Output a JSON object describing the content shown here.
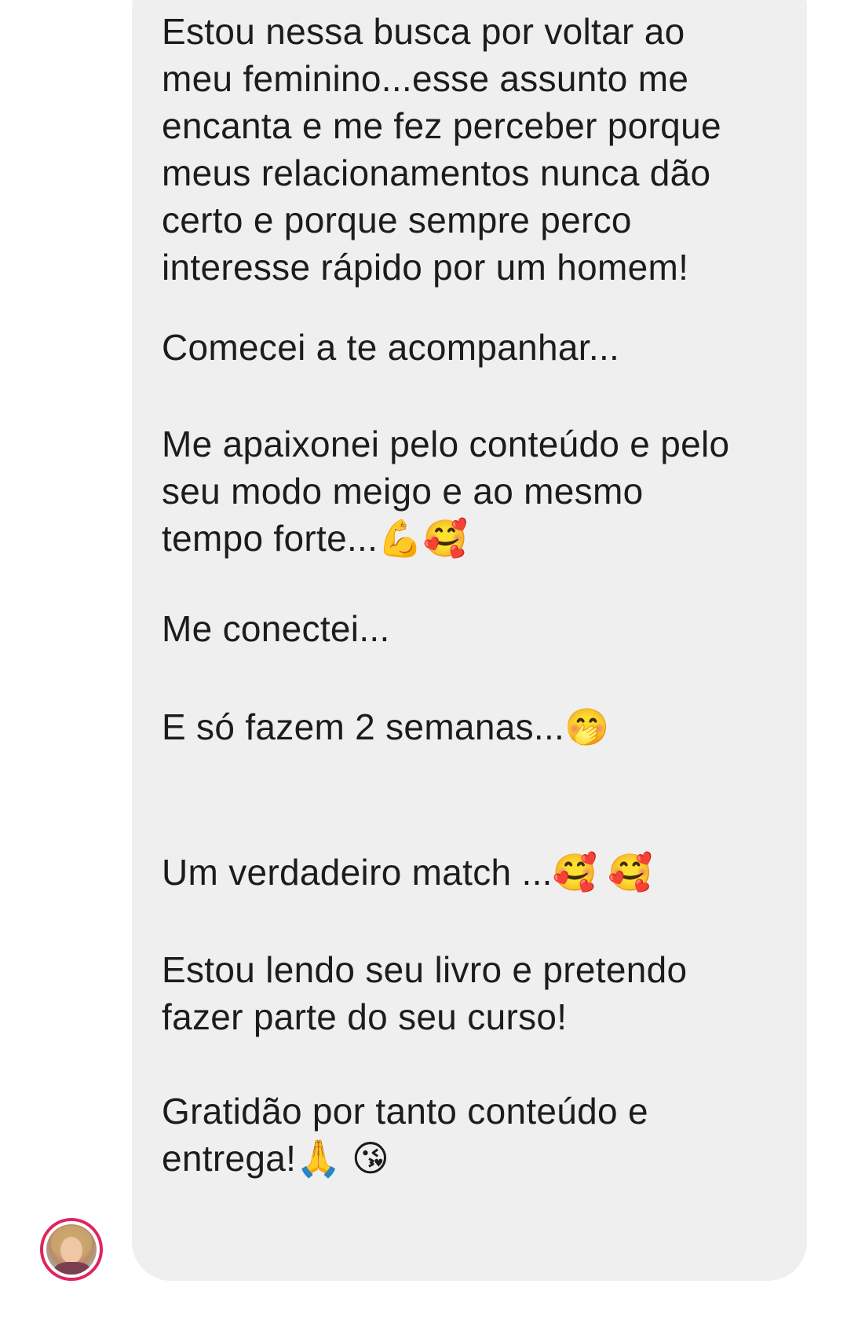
{
  "message": {
    "paragraphs": [
      "Estou nessa busca por voltar ao\nmeu feminino...esse assunto me\nencanta e me fez perceber porque\nmeus relacionamentos nunca dão\ncerto e porque sempre perco\ninteresse rápido por um homem!",
      "Comecei a te acompanhar...",
      "Me apaixonei pelo conteúdo e pelo\nseu modo meigo e ao mesmo\ntempo forte...💪🥰",
      "Me conectei...",
      "E só fazem 2 semanas...🤭",
      "Um verdadeiro match ...🥰 🥰",
      "Estou lendo seu livro e pretendo\nfazer parte do seu curso!",
      "Gratidão por tanto conteúdo e\nentrega!🙏 😘"
    ]
  },
  "sender": {
    "avatar": "profile-photo-avatar",
    "story_ring_color": "#e0245e"
  },
  "colors": {
    "bubble_background": "#efefef",
    "text": "#1c1c1c",
    "page_background": "#ffffff"
  }
}
